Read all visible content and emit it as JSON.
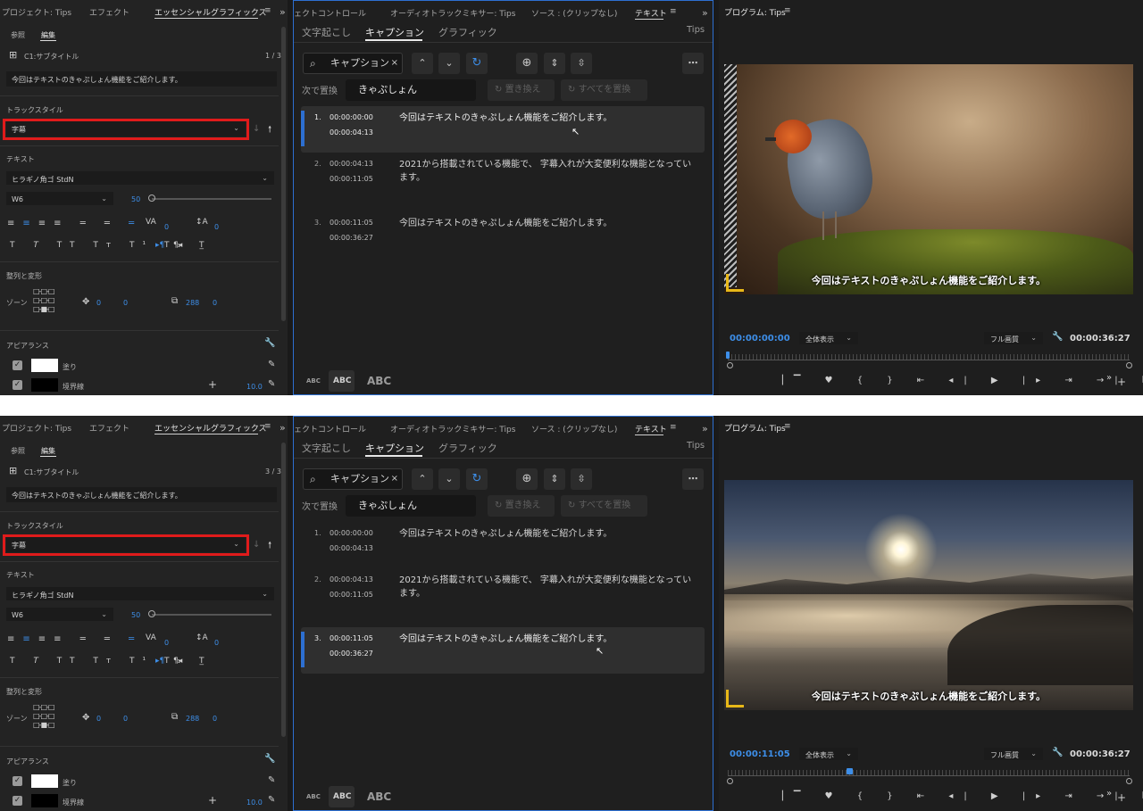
{
  "tabs_left": {
    "project": "プロジェクト: Tips",
    "effects": "エフェクト",
    "essential": "エッセンシャルグラフィックス",
    "more": "»"
  },
  "tabs_mid": {
    "effect_controls": "ェクトコントロール",
    "audio_mixer": "オーディオトラックミキサー: Tips",
    "source": "ソース : (クリップなし)",
    "text": "テキスト",
    "more": "»"
  },
  "tabs_right": {
    "program": "プログラム: Tips"
  },
  "menu_icon": "≡",
  "eg": {
    "browse": "参照",
    "edit": "編集",
    "clip_name": "C1:サブタイトル",
    "caption_text": "今回はテキストのきゃぷしょん機能をご紹介します。",
    "track_style_label": "トラックスタイル",
    "track_style_value": "字幕",
    "text_label": "テキスト",
    "font": "ヒラギノ角ゴ StdN",
    "weight": "W6",
    "size": "50",
    "kerning": "0",
    "leading": "0",
    "align_label": "整列と変形",
    "zone_label": "ゾーン",
    "pos_x": "0",
    "pos_y": "0",
    "scale_x": "288",
    "scale_y": "0",
    "appearance_label": "アピアランス",
    "fill_label": "塗り",
    "stroke_label": "境界線",
    "stroke_value": "10.0",
    "fill_color": "#ffffff",
    "stroke_color": "#000000"
  },
  "text_panel": {
    "tabs": [
      "文字起こし",
      "キャプション",
      "グラフィック"
    ],
    "sequence": "Tips",
    "search_value": "キャプション",
    "replace_label": "次で置換",
    "replace_value": "きゃぷしょん",
    "replace_button": "置き換え",
    "replace_all_button": "すべてを置換",
    "captions": [
      {
        "num": "1.",
        "in": "00:00:00:00",
        "out": "00:00:04:13",
        "text": "今回はテキストのきゃぷしょん機能をご紹介します。"
      },
      {
        "num": "2.",
        "in": "00:00:04:13",
        "out": "00:00:11:05",
        "text": "2021から搭載されている機能で、 字幕入れが大変便利な機能となっています。"
      },
      {
        "num": "3.",
        "in": "00:00:11:05",
        "out": "00:00:36:27",
        "text": "今回はテキストのきゃぷしょん機能をご紹介します。"
      }
    ],
    "abc_small": "ABC",
    "abc_mid": "ABC",
    "abc_large": "ABC"
  },
  "program": {
    "fit": "全体表示",
    "quality": "フル画質",
    "duration": "00:00:36:27",
    "overlay_caption": "今回はテキストのきゃぷしょん機能をご紹介します。"
  },
  "shots": [
    {
      "page_counter": "1 / 3",
      "timecode": "00:00:00:00",
      "selected": 1,
      "progress": 0.0
    },
    {
      "page_counter": "3 / 3",
      "timecode": "00:00:11:05",
      "selected": 3,
      "progress": 0.3
    }
  ],
  "icons": {
    "search": "search-icon",
    "clear": "close-icon",
    "prev": "chevron-up-icon",
    "next": "chevron-down-icon",
    "sync": "sync-icon",
    "add": "add-icon",
    "merge": "merge-icon",
    "split": "split-icon",
    "more": "more-icon",
    "wrench": "wrench-icon",
    "eyedropper": "eyedropper-icon"
  },
  "colors": {
    "accent_blue": "#2d6fd1",
    "highlight_red": "#e01b1b",
    "corner_yellow": "#e8b818"
  }
}
